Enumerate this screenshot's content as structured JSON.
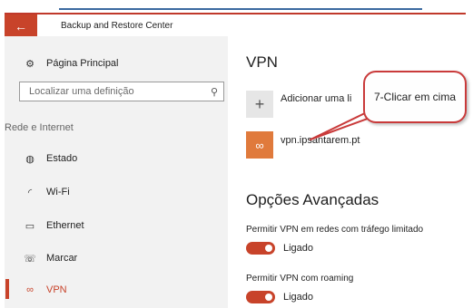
{
  "window": {
    "back_glyph": "←",
    "title": "Backup and Restore Center"
  },
  "sidebar": {
    "home": {
      "label": "Página Principal",
      "icon": "gear-icon"
    },
    "search": {
      "placeholder": "Localizar uma definição"
    },
    "section": "Rede e Internet",
    "items": [
      {
        "label": "Estado",
        "icon": "globe-icon"
      },
      {
        "label": "Wi-Fi",
        "icon": "wifi-icon"
      },
      {
        "label": "Ethernet",
        "icon": "ethernet-icon"
      },
      {
        "label": "Marcar",
        "icon": "dialup-icon"
      },
      {
        "label": "VPN",
        "icon": "vpn-icon",
        "selected": true
      }
    ]
  },
  "main": {
    "title": "VPN",
    "add_label": "Adicionar uma li",
    "connection": {
      "name": "vpn.ipsantarem.pt"
    },
    "advanced_title": "Opções Avançadas",
    "options": [
      {
        "label": "Permitir VPN em redes com tráfego limitado",
        "state": "Ligado"
      },
      {
        "label": "Permitir VPN com roaming",
        "state": "Ligado"
      }
    ]
  },
  "annotation": {
    "text": "7-Clicar em cima"
  },
  "colors": {
    "accent": "#c8432a",
    "vpn_tile": "#e07a3c",
    "callout_border": "#c93a3a"
  }
}
